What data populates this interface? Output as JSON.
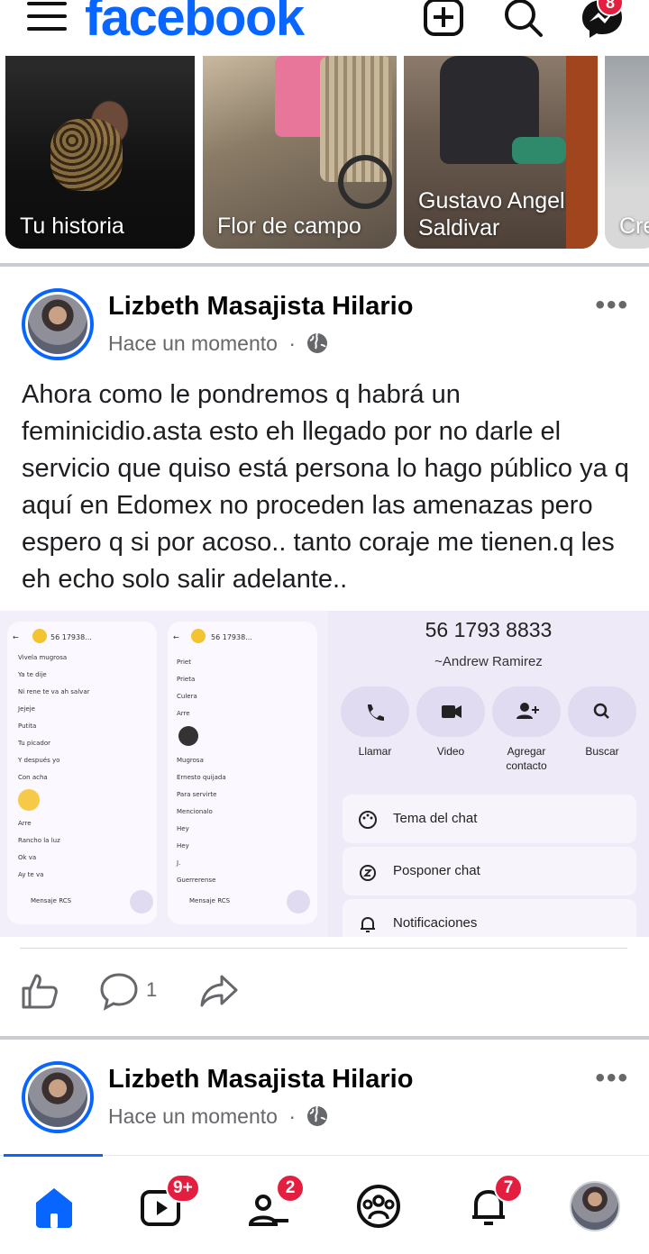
{
  "header": {
    "logo": "facebook",
    "messenger_badge": "8"
  },
  "stories": [
    {
      "label": "Tu historia"
    },
    {
      "label": "Flor de campo"
    },
    {
      "label": "Gustavo Angel Saldivar"
    },
    {
      "label": "Cre"
    }
  ],
  "post": {
    "author": "Lizbeth Masajista Hilario",
    "time": "Hace un momento",
    "separator": "·",
    "text": "Ahora como le pondremos q habrá un feminicidio.asta esto eh llegado por no darle el servicio que quiso está persona lo hago público ya q aquí en Edomex no proceden las amenazas pero  espero q si por acoso.. tanto coraje me tienen.q les eh echo solo salir adelante..",
    "comment_count": "1",
    "screenshots": {
      "chat1": {
        "header": "56 17938...",
        "lines": [
          "Vivela mugrosa",
          "Ya te dije",
          "Ni rene te va ah salvar",
          "Jejeje",
          "Putita",
          "Tu picador",
          "Y después yo",
          "Con acha",
          "Arre",
          "Rancho la luz",
          "Ok va",
          "Ay te va"
        ],
        "composer": "Mensaje RCS"
      },
      "chat2": {
        "header": "56 17938...",
        "lines": [
          "Priet",
          "Prieta",
          "Culera",
          "Arre",
          "Mugrosa",
          "Ernesto quijada",
          "Para servirte",
          "Mencionalo",
          "Hey",
          "Hey",
          "J.",
          "Guerrerense"
        ],
        "composer": "Mensaje RCS"
      },
      "contact": {
        "number": "56 1793 8833",
        "name": "~Andrew Ramirez",
        "actions": [
          "Llamar",
          "Video",
          "Agregar contacto",
          "Buscar"
        ],
        "rows": [
          "Tema del chat",
          "Posponer chat",
          "Notificaciones"
        ]
      }
    }
  },
  "post2": {
    "author": "Lizbeth Masajista Hilario",
    "time": "Hace un momento",
    "separator": "·"
  },
  "nav": {
    "video_badge": "9+",
    "friends_badge": "2",
    "notifications_badge": "7"
  }
}
